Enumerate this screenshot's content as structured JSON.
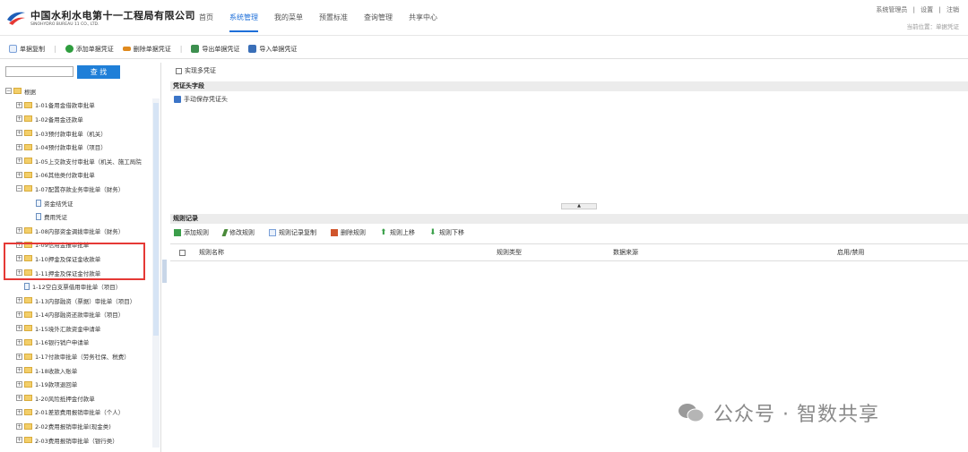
{
  "header": {
    "company_name": "中国水利水电第十一工程局有限公司",
    "company_sub": "SINOHYDRO BUREAU 11 CO., LTD.",
    "nav": [
      "首页",
      "系统管理",
      "我的菜单",
      "预置标准",
      "查询管理",
      "共享中心"
    ],
    "active_nav": 1,
    "top_links": [
      "系统管理员",
      "|",
      "设置",
      "|",
      "注销"
    ],
    "location": "当前位置：单据凭证"
  },
  "toolbar": {
    "items": [
      {
        "label": "单据复制",
        "icon": "copy-icon",
        "color": "#7aa0d8"
      },
      {
        "label": "添加单据凭证",
        "icon": "add-icon",
        "color": "#2e9d3e"
      },
      {
        "label": "删除单据凭证",
        "icon": "delete-icon",
        "color": "#e08a1e"
      },
      {
        "label": "导出单据凭证",
        "icon": "export-icon",
        "color": "#3d8f4f"
      },
      {
        "label": "导入单据凭证",
        "icon": "import-icon",
        "color": "#3a6fb8"
      }
    ]
  },
  "left": {
    "search_button": "查 找",
    "root": "根据",
    "tree": [
      {
        "label": "1-01备用金借款审批单",
        "type": "folder"
      },
      {
        "label": "1-02备用金还款单",
        "type": "folder"
      },
      {
        "label": "1-03预付款审批单（机关）",
        "type": "folder"
      },
      {
        "label": "1-04预付款审批单（项目）",
        "type": "folder"
      },
      {
        "label": "1-05上交款支付审批单（机关、施工局院",
        "type": "folder"
      },
      {
        "label": "1-06其他类付款审批单",
        "type": "folder"
      },
      {
        "label": "1-07配置存款业务审批单（财务）",
        "type": "folder"
      },
      {
        "label": "资金结凭证",
        "type": "doc-child"
      },
      {
        "label": "费用凭证",
        "type": "doc-child"
      },
      {
        "label": "1-08内部资金调拨审批单（财务）",
        "type": "folder"
      },
      {
        "label": "1-09信用金报审批单",
        "type": "folder"
      },
      {
        "label": "1-10押金及保证金收款单",
        "type": "folder"
      },
      {
        "label": "1-11押金及保证金付款单",
        "type": "folder"
      },
      {
        "label": "1-12空白支票借用审批单（项目）",
        "type": "doc"
      },
      {
        "label": "1-13内部融资（票据）审批单（项目）",
        "type": "folder"
      },
      {
        "label": "1-14内部融资还款审批单（项目）",
        "type": "folder"
      },
      {
        "label": "1-15境外汇款资金申请单",
        "type": "folder"
      },
      {
        "label": "1-16银行销户申请单",
        "type": "folder"
      },
      {
        "label": "1-17付款审批单（劳务社保、税费）",
        "type": "folder"
      },
      {
        "label": "1-18收款入账单",
        "type": "folder"
      },
      {
        "label": "1-19款项退回单",
        "type": "folder"
      },
      {
        "label": "1-20风险抵押金付款单",
        "type": "folder"
      },
      {
        "label": "2-01差旅费用报销审批单（个人）",
        "type": "folder"
      },
      {
        "label": "2-02费用报销审批单(现金类)",
        "type": "folder"
      },
      {
        "label": "2-03费用报销审批单（银行类）",
        "type": "folder"
      }
    ]
  },
  "right": {
    "multi_voucher": "实现多凭证",
    "voucher_header_section": "凭证头字段",
    "manual_save": "手动保存凭证头",
    "rules_section": "规则记录",
    "rules_toolbar": [
      {
        "label": "添加规则",
        "icon": "add-rule-icon",
        "color": "#3b9e4a"
      },
      {
        "label": "修改规则",
        "icon": "edit-rule-icon",
        "color": "#4a8a3a"
      },
      {
        "label": "规则记录复制",
        "icon": "copy-rule-icon",
        "color": "#7aa0d8"
      },
      {
        "label": "删除规则",
        "icon": "delete-rule-icon",
        "color": "#d0552c"
      },
      {
        "label": "规则上移",
        "icon": "arrow-up-icon",
        "color": "#3aa04a"
      },
      {
        "label": "规则下移",
        "icon": "arrow-down-icon",
        "color": "#3aa04a"
      }
    ],
    "columns": [
      "规则名称",
      "规则类型",
      "数据来源",
      "启用/禁用"
    ]
  },
  "watermark": "公众号 · 智数共享"
}
